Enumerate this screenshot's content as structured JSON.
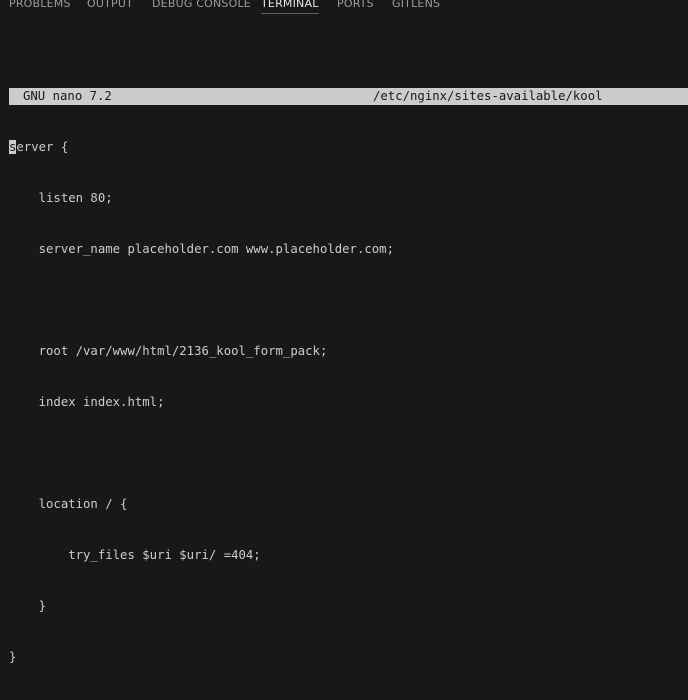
{
  "panel": {
    "tabs": [
      {
        "label": "PROBLEMS"
      },
      {
        "label": "OUTPUT"
      },
      {
        "label": "DEBUG CONSOLE"
      },
      {
        "label": "TERMINAL"
      },
      {
        "label": "PORTS"
      },
      {
        "label": "GITLENS"
      }
    ],
    "active_tab": "TERMINAL"
  },
  "nano": {
    "title": "GNU nano 7.2",
    "filename": "/etc/nginx/sites-available/kool",
    "cursor_char": "s",
    "lines": [
      "erver {",
      "    listen 80;",
      "    server_name placeholder.com www.placeholder.com;",
      "",
      "    root /var/www/html/2136_kool_form_pack;",
      "    index index.html;",
      "",
      "    location / {",
      "        try_files $uri $uri/ =404;",
      "    }",
      "}"
    ]
  },
  "colors": {
    "background": "#181818",
    "text": "#cccccc",
    "active_tab_underline": "#0078d4",
    "header_background": "#cccccc"
  }
}
